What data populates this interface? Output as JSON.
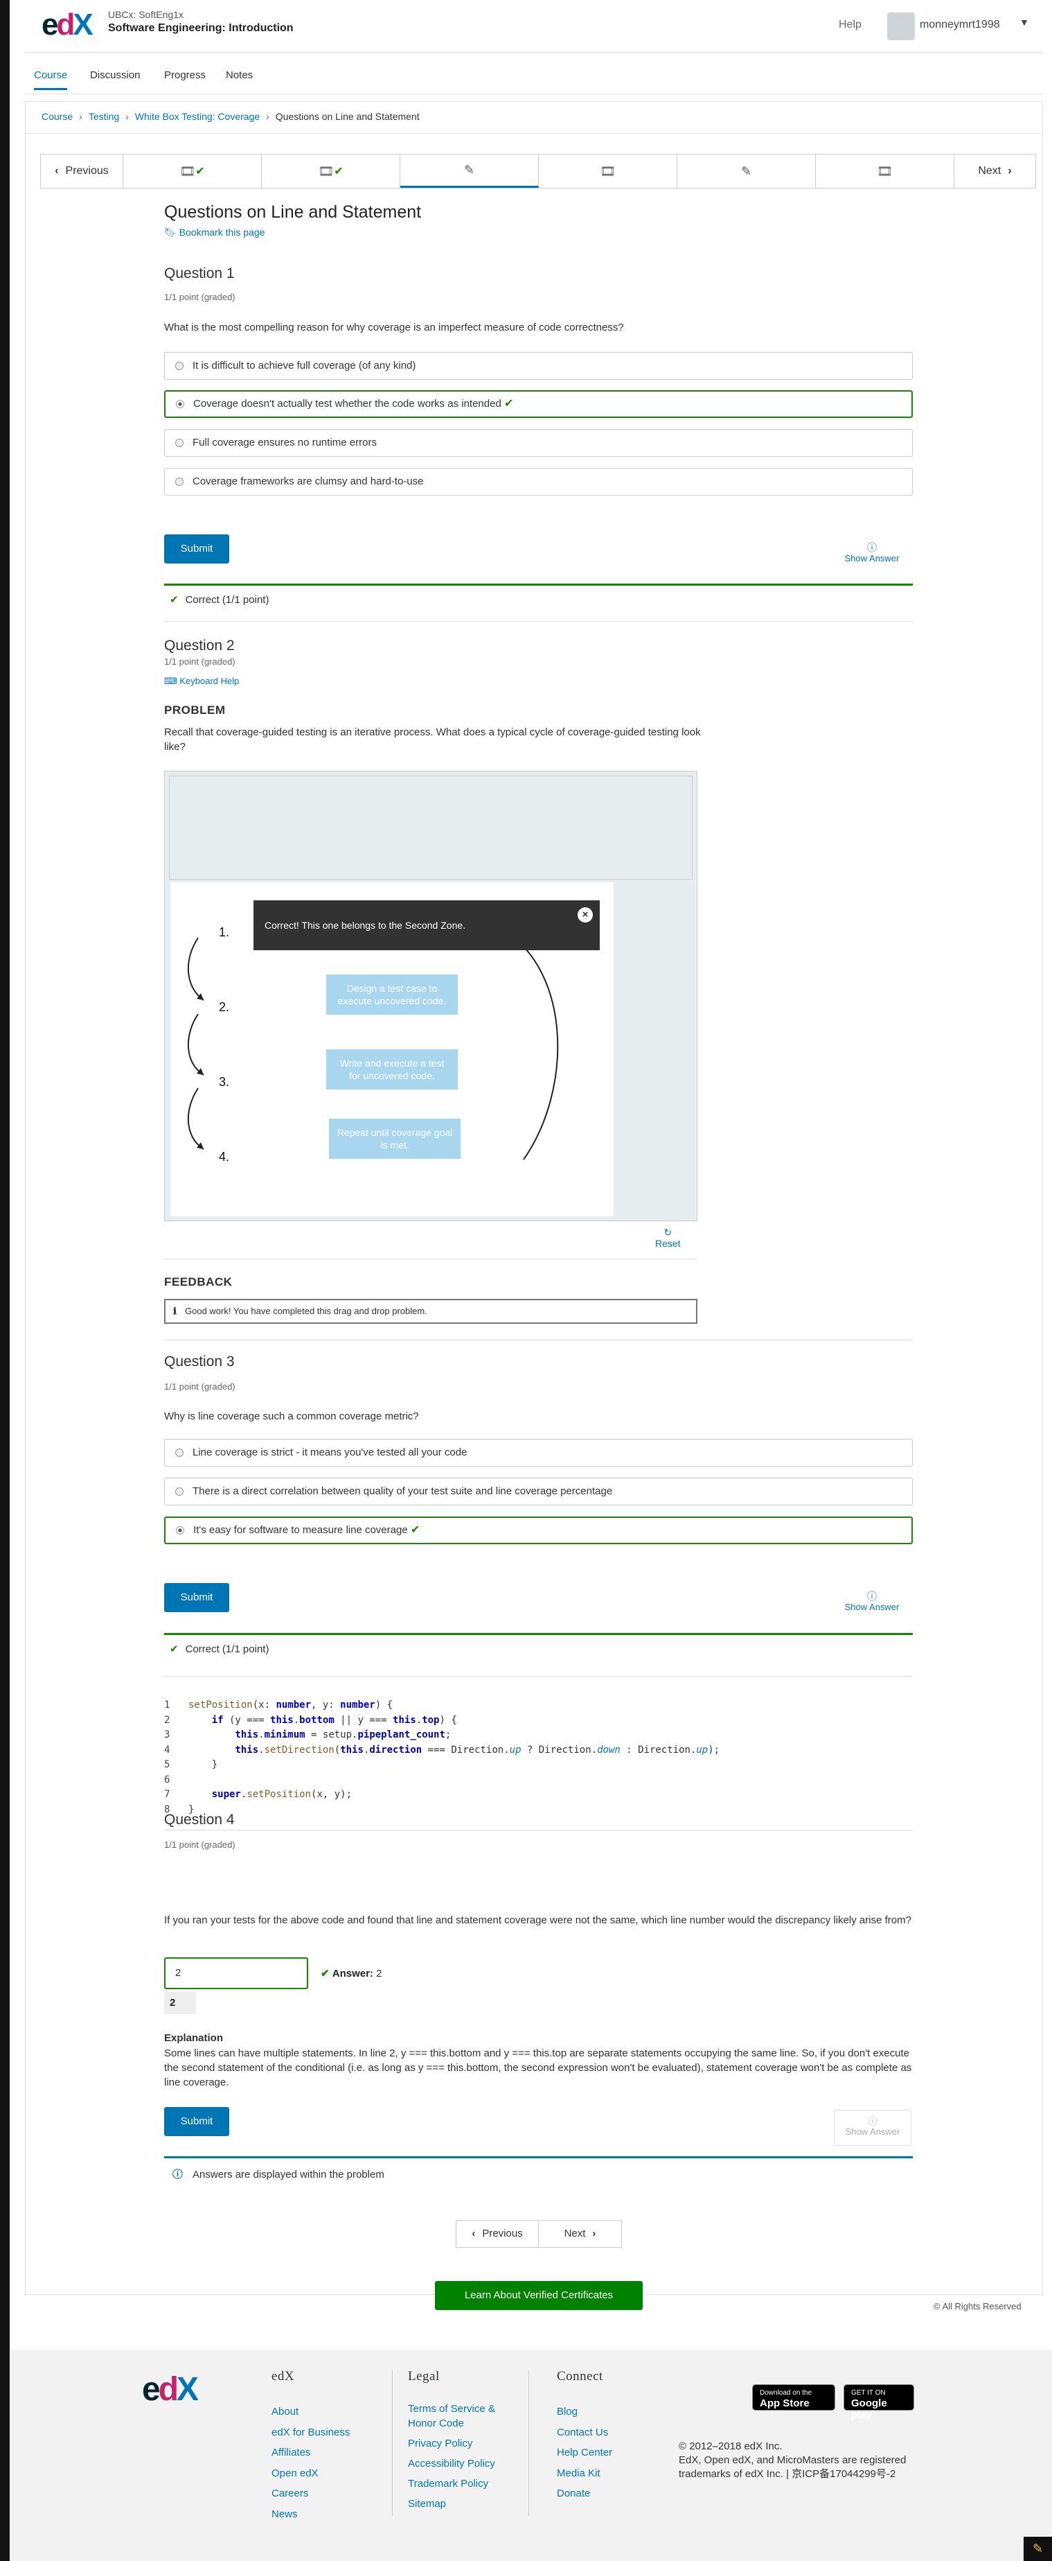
{
  "header": {
    "org": "UBCx: SoftEng1x",
    "course_title": "Software Engineering: Introduction",
    "help": "Help",
    "username": "monneymrt1998"
  },
  "tabs": [
    "Course",
    "Discussion",
    "Progress",
    "Notes"
  ],
  "breadcrumb": [
    "Course",
    "Testing",
    "White Box Testing: Coverage",
    "Questions on Line and Statement"
  ],
  "seqnav": {
    "previous": "Previous",
    "next": "Next"
  },
  "page": {
    "title": "Questions on Line and Statement",
    "bookmark": "Bookmark this page"
  },
  "q1": {
    "title": "Question 1",
    "points": "1/1 point (graded)",
    "text": "What is the most compelling reason for why coverage is an imperfect measure of code correctness?",
    "options": [
      "It is difficult to achieve full coverage (of any kind)",
      "Coverage doesn't actually test whether the code works as intended",
      "Full coverage ensures no runtime errors",
      "Coverage frameworks are clumsy and hard-to-use"
    ],
    "submit": "Submit",
    "show_answer": "Show Answer",
    "status": "Correct (1/1 point)"
  },
  "q2": {
    "title": "Question 2",
    "points": "1/1 point (graded)",
    "keyboard_help": "Keyboard Help",
    "problem_label": "PROBLEM",
    "text": "Recall that coverage-guided testing is an iterative process. What does a typical cycle of coverage-guided testing look like?",
    "numbers": [
      "1.",
      "2.",
      "3.",
      "4."
    ],
    "items": [
      "Design a test case to execute uncovered code.",
      "Write and execute a test for uncovered code.",
      "Repeat until coverage goal is met."
    ],
    "popup": "Correct! This one belongs to the Second Zone.",
    "reset": "Reset",
    "feedback_label": "FEEDBACK",
    "feedback": "Good work! You have completed this drag and drop problem."
  },
  "q3": {
    "title": "Question 3",
    "points": "1/1 point (graded)",
    "text": "Why is line coverage such a common coverage metric?",
    "options": [
      "Line coverage is strict - it means you've tested all your code",
      "There is a direct correlation between quality of your test suite and line coverage percentage",
      "It's easy for software to measure line coverage"
    ],
    "submit": "Submit",
    "show_answer": "Show Answer",
    "status": "Correct (1/1 point)"
  },
  "code": {
    "line_numbers": [
      "1",
      "2",
      "3",
      "4",
      "5",
      "6",
      "7",
      "8"
    ],
    "l1": [
      "setPosition",
      "(x: ",
      "number",
      ", y: ",
      "number",
      ") {"
    ],
    "l2": [
      "if",
      " (y === ",
      "this",
      ".",
      "bottom",
      " || y === ",
      "this",
      ".",
      "top",
      ") {"
    ],
    "l3": [
      "this",
      ".",
      "minimum",
      " = setup.",
      "pipeplant_count",
      ";"
    ],
    "l4": [
      "this",
      ".",
      "setDirection",
      "(",
      "this",
      ".",
      "direction",
      " === Direction.",
      "up",
      " ? Direction.",
      "down",
      " : Direction.",
      "up",
      ");"
    ],
    "l5": "}",
    "l7": [
      "super",
      ".",
      "setPosition",
      "(x, y);"
    ],
    "l8": "}"
  },
  "q4": {
    "title": "Question 4",
    "points": "1/1 point (graded)",
    "text": "If you ran your tests for the above code and found that line and statement coverage were not the same, which line number would the discrepancy likely arise from?",
    "input_value": "2",
    "answer_label": "Answer:",
    "answer_value": "2",
    "shown_value": "2",
    "explanation_label": "Explanation",
    "explanation": "Some lines can have multiple statements. In line 2, y === this.bottom and y === this.top are separate statements occupying the same line. So, if you don't execute the second statement of the conditional (i.e. as long as y === this.bottom, the second expression won't be evaluated), statement coverage won't be as complete as line coverage.",
    "submit": "Submit",
    "show_answer": "Show Answer",
    "info": "Answers are displayed within the problem"
  },
  "bottomnav": {
    "previous": "Previous",
    "next": "Next"
  },
  "cert_button": "Learn About Verified Certificates",
  "rights": "© All Rights Reserved",
  "footer": {
    "edx": {
      "heading": "edX",
      "links": [
        "About",
        "edX for Business",
        "Affiliates",
        "Open edX",
        "Careers",
        "News"
      ]
    },
    "legal": {
      "heading": "Legal",
      "links": [
        "Terms of Service & Honor Code",
        "Privacy Policy",
        "Accessibility Policy",
        "Trademark Policy",
        "Sitemap"
      ]
    },
    "connect": {
      "heading": "Connect",
      "links": [
        "Blog",
        "Contact Us",
        "Help Center",
        "Media Kit",
        "Donate"
      ]
    },
    "appstore": {
      "small": "Download on the",
      "big": "App Store"
    },
    "googleplay": {
      "small": "GET IT ON",
      "big": "Google play"
    },
    "copyright": "© 2012–2018 edX Inc.",
    "trademark": "EdX, Open edX, and MicroMasters are registered trademarks of edX Inc. | 京ICP备17044299号-2"
  },
  "colors": {
    "accent": "#0075b4",
    "correct": "#1a8500",
    "cert": "#008100"
  }
}
